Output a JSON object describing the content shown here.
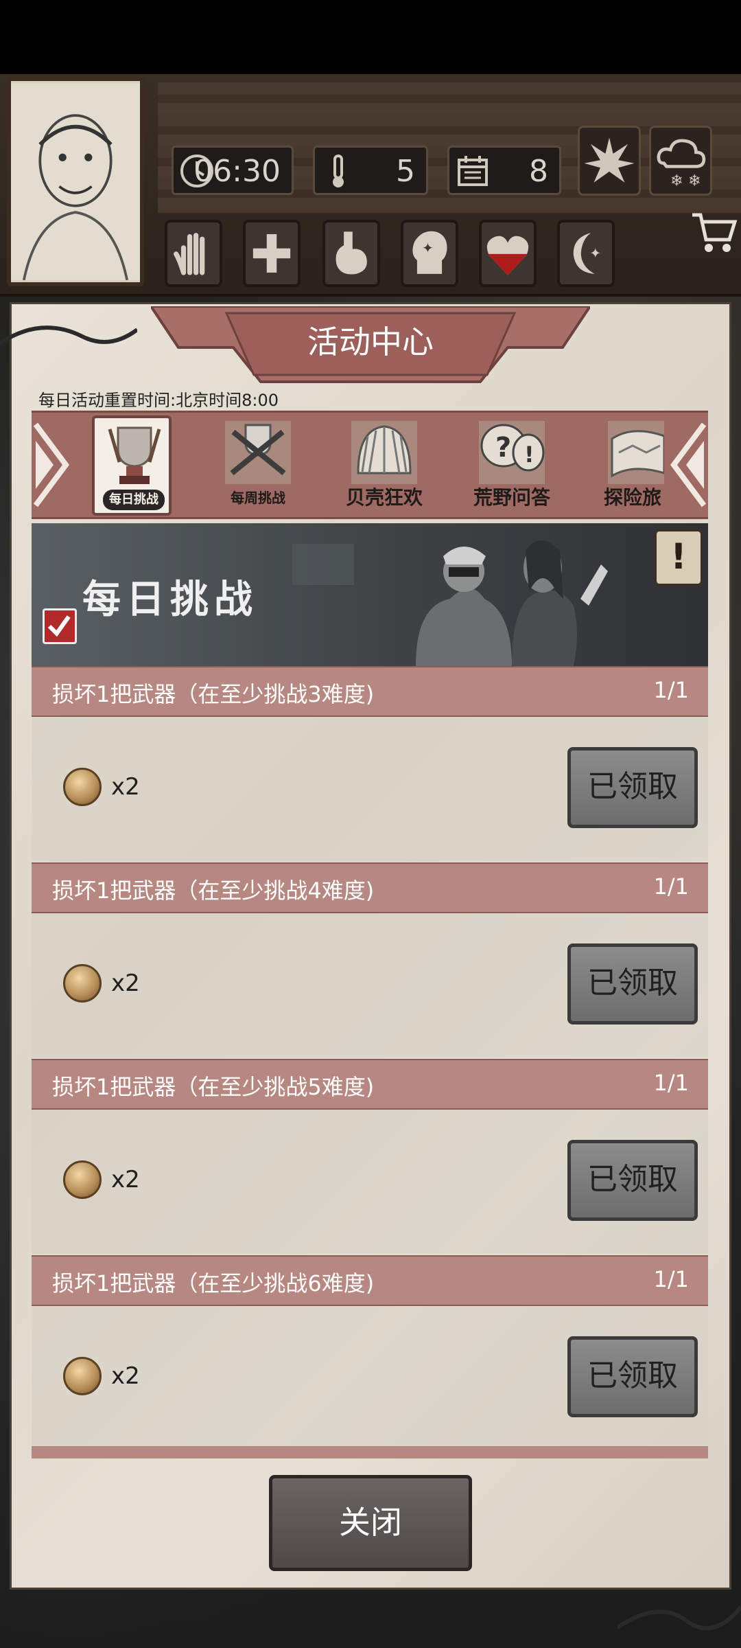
{
  "hud": {
    "time": "06:30",
    "temperature": "5",
    "day": "8"
  },
  "panel": {
    "title": "活动中心",
    "reset_note": "每日活动重置时间:北京时间8:00"
  },
  "tabs": [
    {
      "label": "每日挑战",
      "selected": true
    },
    {
      "label": "每周挑战",
      "selected": false
    },
    {
      "label": "贝壳狂欢",
      "selected": false
    },
    {
      "label": "荒野问答",
      "selected": false
    },
    {
      "label": "探险旅",
      "selected": false
    }
  ],
  "hero": {
    "title": "每日挑战",
    "warn_symbol": "!"
  },
  "tasks": [
    {
      "name": "损坏1把武器（在至少挑战3难度)",
      "progress": "1/1",
      "reward_qty": "x2",
      "button": "已领取"
    },
    {
      "name": "损坏1把武器（在至少挑战4难度)",
      "progress": "1/1",
      "reward_qty": "x2",
      "button": "已领取"
    },
    {
      "name": "损坏1把武器（在至少挑战5难度)",
      "progress": "1/1",
      "reward_qty": "x2",
      "button": "已领取"
    },
    {
      "name": "损坏1把武器（在至少挑战6难度)",
      "progress": "1/1",
      "reward_qty": "x2",
      "button": "已领取"
    }
  ],
  "close_label": "关闭",
  "colors": {
    "banner": "#a06a64",
    "task_header": "#b78882",
    "paper": "#e6e0d6"
  }
}
